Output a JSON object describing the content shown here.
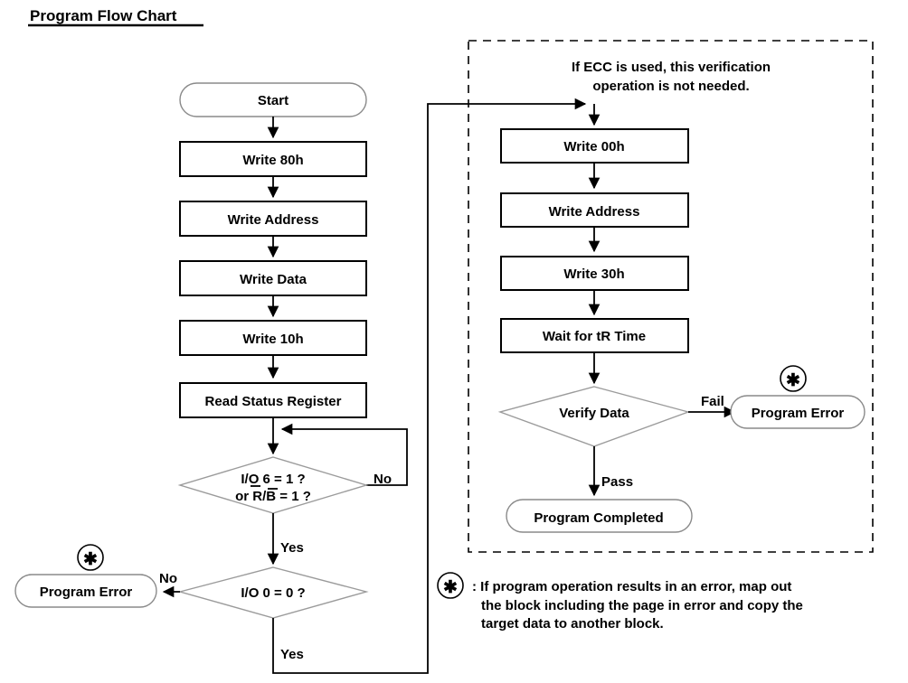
{
  "title": "Program Flow Chart",
  "colors": {
    "ink": "#000000",
    "box_stroke": "#000000",
    "terminal_stroke": "#8a8a8a",
    "diamond_stroke": "#9b9b9b",
    "background": "#ffffff"
  },
  "chart_data": {
    "type": "diagram",
    "title": "Program Flow Chart",
    "nodes": [
      {
        "id": "start",
        "shape": "terminal",
        "label": "Start"
      },
      {
        "id": "write80h",
        "shape": "process",
        "label": "Write 80h"
      },
      {
        "id": "write_address_left",
        "shape": "process",
        "label": "Write Address"
      },
      {
        "id": "write_data",
        "shape": "process",
        "label": "Write Data"
      },
      {
        "id": "write10h",
        "shape": "process",
        "label": "Write 10h"
      },
      {
        "id": "read_status_register",
        "shape": "process",
        "label": "Read Status Register"
      },
      {
        "id": "decision_io6",
        "shape": "decision",
        "label_line1": "I/O 6 = 1 ?",
        "label_line2": "or R/B = 1 ?"
      },
      {
        "id": "decision_io0",
        "shape": "decision",
        "label": "I/O 0 = 0 ?"
      },
      {
        "id": "program_error_left",
        "shape": "terminal",
        "label": "Program Error"
      },
      {
        "id": "write00h",
        "shape": "process",
        "label": "Write 00h"
      },
      {
        "id": "write_address_right",
        "shape": "process",
        "label": "Write Address"
      },
      {
        "id": "write30h",
        "shape": "process",
        "label": "Write 30h"
      },
      {
        "id": "wait_tr_time",
        "shape": "process",
        "label": "Wait for tR Time"
      },
      {
        "id": "verify_data",
        "shape": "decision",
        "label": "Verify Data"
      },
      {
        "id": "program_error_right",
        "shape": "terminal",
        "label": "Program Error"
      },
      {
        "id": "program_completed",
        "shape": "terminal",
        "label": "Program Completed"
      }
    ],
    "edge_labels": {
      "io6_no": "No",
      "io6_yes": "Yes",
      "io0_no": "No",
      "io0_yes": "Yes",
      "verify_fail": "Fail",
      "verify_pass": "Pass"
    },
    "annotations": {
      "ecc_note_line1": "If ECC is used, this verification",
      "ecc_note_line2": "operation is not needed.",
      "asterisk_symbol": "✱",
      "footnote_line1": ": If program operation results in an error, map out",
      "footnote_line2": "the block including the page in error and copy the",
      "footnote_line3": "target data to another block."
    }
  }
}
